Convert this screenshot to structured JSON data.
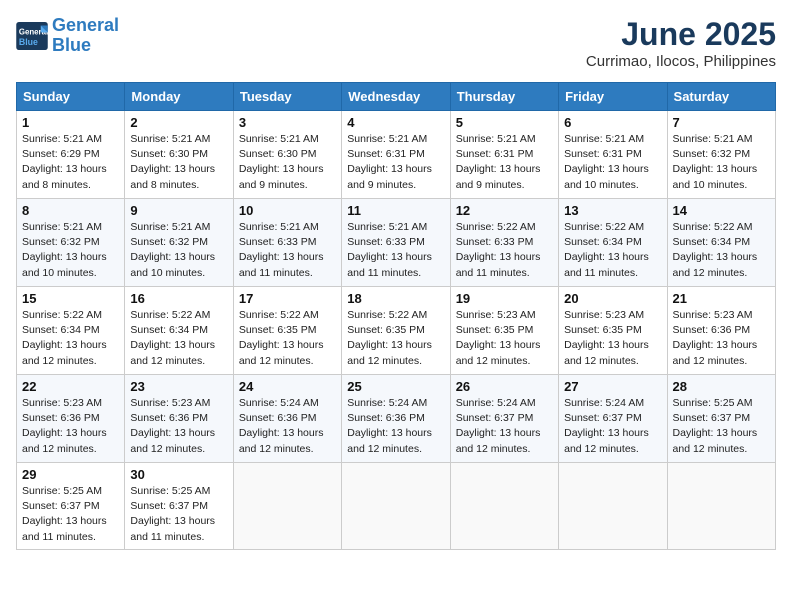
{
  "header": {
    "logo_line1": "General",
    "logo_line2": "Blue",
    "month_title": "June 2025",
    "subtitle": "Currimao, Ilocos, Philippines"
  },
  "weekdays": [
    "Sunday",
    "Monday",
    "Tuesday",
    "Wednesday",
    "Thursday",
    "Friday",
    "Saturday"
  ],
  "weeks": [
    [
      {
        "day": "1",
        "sunrise": "5:21 AM",
        "sunset": "6:29 PM",
        "daylight": "13 hours and 8 minutes."
      },
      {
        "day": "2",
        "sunrise": "5:21 AM",
        "sunset": "6:30 PM",
        "daylight": "13 hours and 8 minutes."
      },
      {
        "day": "3",
        "sunrise": "5:21 AM",
        "sunset": "6:30 PM",
        "daylight": "13 hours and 9 minutes."
      },
      {
        "day": "4",
        "sunrise": "5:21 AM",
        "sunset": "6:31 PM",
        "daylight": "13 hours and 9 minutes."
      },
      {
        "day": "5",
        "sunrise": "5:21 AM",
        "sunset": "6:31 PM",
        "daylight": "13 hours and 9 minutes."
      },
      {
        "day": "6",
        "sunrise": "5:21 AM",
        "sunset": "6:31 PM",
        "daylight": "13 hours and 10 minutes."
      },
      {
        "day": "7",
        "sunrise": "5:21 AM",
        "sunset": "6:32 PM",
        "daylight": "13 hours and 10 minutes."
      }
    ],
    [
      {
        "day": "8",
        "sunrise": "5:21 AM",
        "sunset": "6:32 PM",
        "daylight": "13 hours and 10 minutes."
      },
      {
        "day": "9",
        "sunrise": "5:21 AM",
        "sunset": "6:32 PM",
        "daylight": "13 hours and 10 minutes."
      },
      {
        "day": "10",
        "sunrise": "5:21 AM",
        "sunset": "6:33 PM",
        "daylight": "13 hours and 11 minutes."
      },
      {
        "day": "11",
        "sunrise": "5:21 AM",
        "sunset": "6:33 PM",
        "daylight": "13 hours and 11 minutes."
      },
      {
        "day": "12",
        "sunrise": "5:22 AM",
        "sunset": "6:33 PM",
        "daylight": "13 hours and 11 minutes."
      },
      {
        "day": "13",
        "sunrise": "5:22 AM",
        "sunset": "6:34 PM",
        "daylight": "13 hours and 11 minutes."
      },
      {
        "day": "14",
        "sunrise": "5:22 AM",
        "sunset": "6:34 PM",
        "daylight": "13 hours and 12 minutes."
      }
    ],
    [
      {
        "day": "15",
        "sunrise": "5:22 AM",
        "sunset": "6:34 PM",
        "daylight": "13 hours and 12 minutes."
      },
      {
        "day": "16",
        "sunrise": "5:22 AM",
        "sunset": "6:34 PM",
        "daylight": "13 hours and 12 minutes."
      },
      {
        "day": "17",
        "sunrise": "5:22 AM",
        "sunset": "6:35 PM",
        "daylight": "13 hours and 12 minutes."
      },
      {
        "day": "18",
        "sunrise": "5:22 AM",
        "sunset": "6:35 PM",
        "daylight": "13 hours and 12 minutes."
      },
      {
        "day": "19",
        "sunrise": "5:23 AM",
        "sunset": "6:35 PM",
        "daylight": "13 hours and 12 minutes."
      },
      {
        "day": "20",
        "sunrise": "5:23 AM",
        "sunset": "6:35 PM",
        "daylight": "13 hours and 12 minutes."
      },
      {
        "day": "21",
        "sunrise": "5:23 AM",
        "sunset": "6:36 PM",
        "daylight": "13 hours and 12 minutes."
      }
    ],
    [
      {
        "day": "22",
        "sunrise": "5:23 AM",
        "sunset": "6:36 PM",
        "daylight": "13 hours and 12 minutes."
      },
      {
        "day": "23",
        "sunrise": "5:23 AM",
        "sunset": "6:36 PM",
        "daylight": "13 hours and 12 minutes."
      },
      {
        "day": "24",
        "sunrise": "5:24 AM",
        "sunset": "6:36 PM",
        "daylight": "13 hours and 12 minutes."
      },
      {
        "day": "25",
        "sunrise": "5:24 AM",
        "sunset": "6:36 PM",
        "daylight": "13 hours and 12 minutes."
      },
      {
        "day": "26",
        "sunrise": "5:24 AM",
        "sunset": "6:37 PM",
        "daylight": "13 hours and 12 minutes."
      },
      {
        "day": "27",
        "sunrise": "5:24 AM",
        "sunset": "6:37 PM",
        "daylight": "13 hours and 12 minutes."
      },
      {
        "day": "28",
        "sunrise": "5:25 AM",
        "sunset": "6:37 PM",
        "daylight": "13 hours and 12 minutes."
      }
    ],
    [
      {
        "day": "29",
        "sunrise": "5:25 AM",
        "sunset": "6:37 PM",
        "daylight": "13 hours and 11 minutes."
      },
      {
        "day": "30",
        "sunrise": "5:25 AM",
        "sunset": "6:37 PM",
        "daylight": "13 hours and 11 minutes."
      },
      null,
      null,
      null,
      null,
      null
    ]
  ],
  "labels": {
    "sunrise": "Sunrise:",
    "sunset": "Sunset:",
    "daylight": "Daylight: "
  }
}
